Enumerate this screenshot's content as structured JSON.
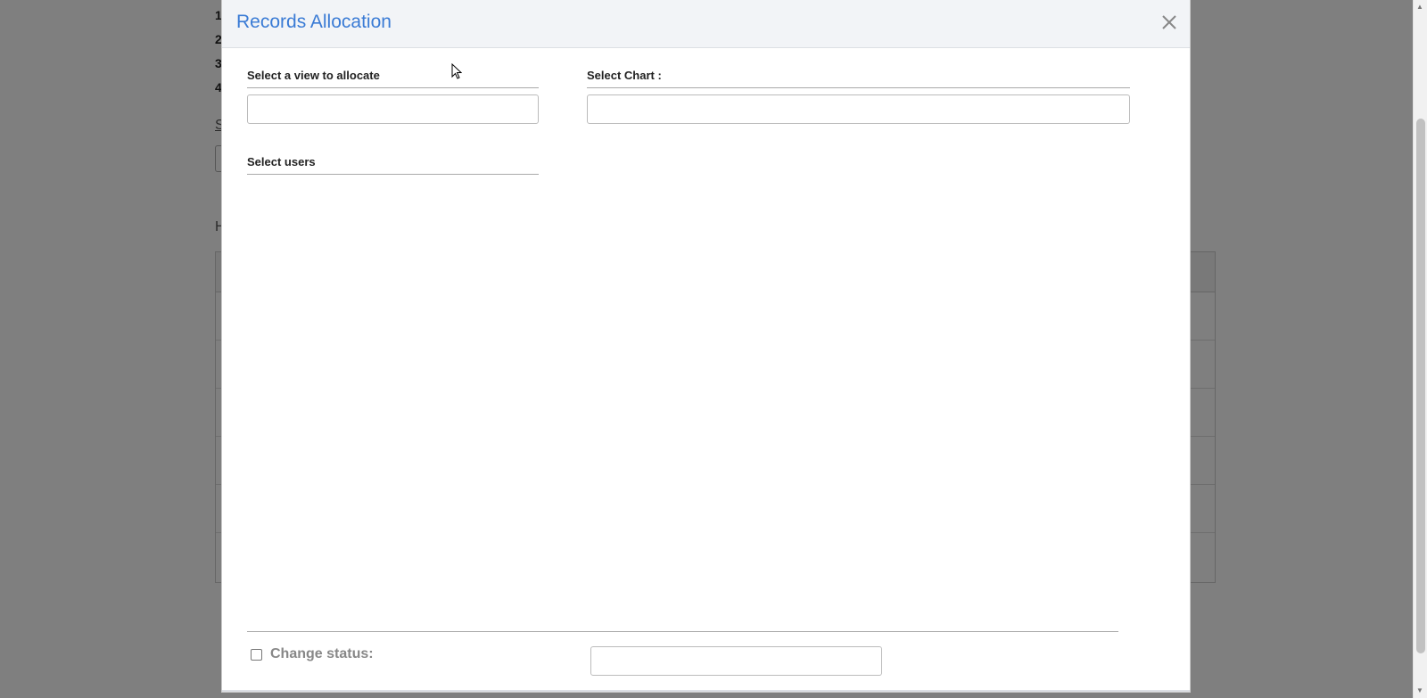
{
  "background": {
    "list_numbers": [
      "1",
      "2",
      "3",
      "4"
    ],
    "select_label": "S",
    "heading": "H"
  },
  "modal": {
    "title": "Records Allocation",
    "close_icon": "close-icon",
    "view_label": "Select a view to allocate",
    "view_value": "",
    "chart_label": "Select Chart :",
    "chart_value": "",
    "users_label": "Select users",
    "change_status": {
      "label": "Change status:",
      "checked": false,
      "value": ""
    }
  },
  "colors": {
    "title": "#3a7bd5",
    "overlay": "rgba(0,0,0,0.5)",
    "header_bg": "#f2f4f7"
  }
}
